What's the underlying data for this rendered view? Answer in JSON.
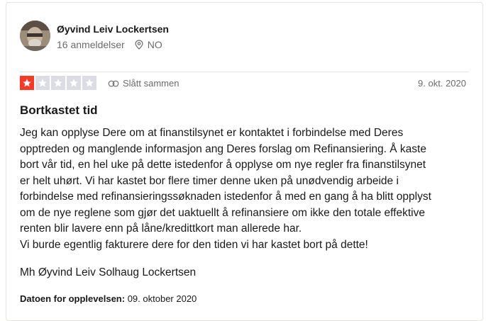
{
  "user": {
    "name": "Øyvind Leiv Lockertsen",
    "reviews_count": "16 anmeldelser",
    "country": "NO",
    "avatar_icon": "user-avatar"
  },
  "review": {
    "rating": 1,
    "rating_max": 5,
    "star_color_active": "#ff3722",
    "star_color_inactive": "#dcdce6",
    "merged_label": "Slått sammen",
    "date": "9. okt. 2020",
    "title": "Bortkastet tid",
    "body": "Jeg kan opplyse Dere om at finanstilsynet er kontaktet i forbindelse med Deres\nopptreden og manglende informasjon ang Deres forslag om Refinansiering. Å kaste\nbort vår tid, en hel uke på dette istedenfor å opplyse om nye regler fra finanstilsynet\ner helt uhørt. Vi har kastet bor flere timer denne uken på unødvendig arbeide i\nforbindelse med refinansieringssøknaden istedenfor å med en gang å ha blitt opplyst\nom de nye reglene som gjør det uaktuellt å refinansiere om ikke den totale effektive\nrenten blir lavere enn på låne/kredittkort man allerede har.\nVi burde egentlig fakturere dere for den tiden vi har kastet bort på dette!",
    "signature": "Mh Øyvind Leiv Solhaug Lockertsen",
    "experience_label": "Datoen for opplevelsen:",
    "experience_date": "09. oktober 2020"
  }
}
